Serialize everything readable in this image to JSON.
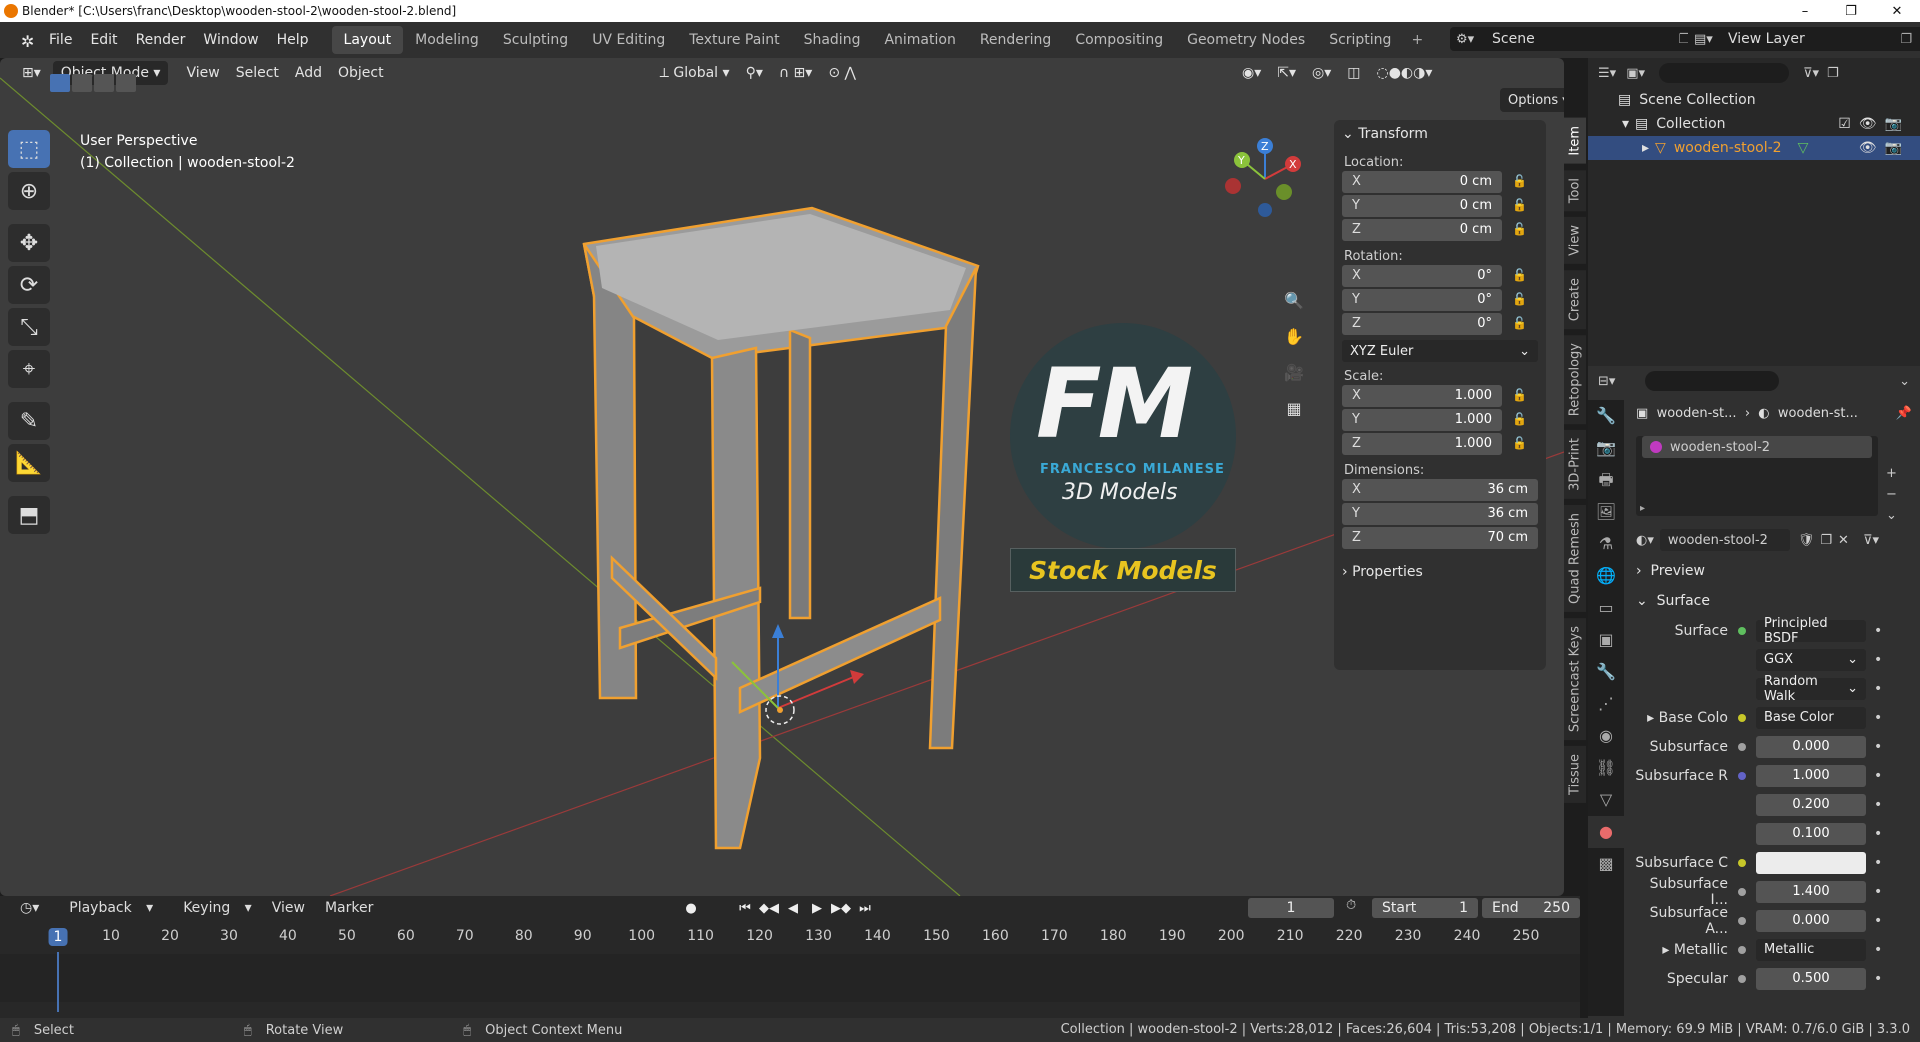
{
  "window": {
    "title": "Blender* [C:\\Users\\franc\\Desktop\\wooden-stool-2\\wooden-stool-2.blend]",
    "minimize": "–",
    "maximize": "❐",
    "close": "✕"
  },
  "menu": [
    "File",
    "Edit",
    "Render",
    "Window",
    "Help"
  ],
  "workspaces": [
    "Layout",
    "Modeling",
    "Sculpting",
    "UV Editing",
    "Texture Paint",
    "Shading",
    "Animation",
    "Rendering",
    "Compositing",
    "Geometry Nodes",
    "Scripting"
  ],
  "workspace_active": "Layout",
  "scene": "Scene",
  "view_layer": "View Layer",
  "viewport": {
    "mode": "Object Mode",
    "menus": [
      "View",
      "Select",
      "Add",
      "Object"
    ],
    "orientation": "Global",
    "options": "Options",
    "info_line1": "User Perspective",
    "info_line2": "(1) Collection | wooden-stool-2"
  },
  "watermark": {
    "letters": "FM",
    "brand": "FRANCESCO MILANESE",
    "tagline": "3D Models",
    "banner": "Stock Models"
  },
  "npanel": {
    "section": "Transform",
    "location_label": "Location:",
    "location": [
      {
        "axis": "X",
        "value": "0 cm"
      },
      {
        "axis": "Y",
        "value": "0 cm"
      },
      {
        "axis": "Z",
        "value": "0 cm"
      }
    ],
    "rotation_label": "Rotation:",
    "rotation": [
      {
        "axis": "X",
        "value": "0°"
      },
      {
        "axis": "Y",
        "value": "0°"
      },
      {
        "axis": "Z",
        "value": "0°"
      }
    ],
    "rotation_mode": "XYZ Euler",
    "scale_label": "Scale:",
    "scale": [
      {
        "axis": "X",
        "value": "1.000"
      },
      {
        "axis": "Y",
        "value": "1.000"
      },
      {
        "axis": "Z",
        "value": "1.000"
      }
    ],
    "dimensions_label": "Dimensions:",
    "dimensions": [
      {
        "axis": "X",
        "value": "36 cm"
      },
      {
        "axis": "Y",
        "value": "36 cm"
      },
      {
        "axis": "Z",
        "value": "70 cm"
      }
    ],
    "properties": "Properties",
    "tabs": [
      "Item",
      "Tool",
      "View",
      "Create",
      "Retopology",
      "3D-Print",
      "Quad Remesh",
      "Screencast Keys",
      "Tissue"
    ]
  },
  "timeline": {
    "menus": [
      "Playback",
      "Keying",
      "View",
      "Marker"
    ],
    "current_frame": "1",
    "start_label": "Start",
    "start": "1",
    "end_label": "End",
    "end": "250",
    "ticks": [
      "1",
      "10",
      "20",
      "30",
      "40",
      "50",
      "60",
      "70",
      "80",
      "90",
      "100",
      "110",
      "120",
      "130",
      "140",
      "150",
      "160",
      "170",
      "180",
      "190",
      "200",
      "210",
      "220",
      "230",
      "240",
      "250"
    ]
  },
  "status": {
    "select": "Select",
    "rotate": "Rotate View",
    "context": "Object Context Menu",
    "stats": "Collection | wooden-stool-2 | Verts:28,012 | Faces:26,604 | Tris:53,208 | Objects:1/1 | Memory: 69.9 MiB | VRAM: 0.7/6.0 GiB | 3.3.0"
  },
  "outliner": {
    "root": "Scene Collection",
    "collection": "Collection",
    "object": "wooden-stool-2"
  },
  "properties": {
    "breadcrumb1": "wooden-st...",
    "breadcrumb2": "wooden-st...",
    "slot": "wooden-stool-2",
    "material": "wooden-stool-2",
    "preview": "Preview",
    "surface_section": "Surface",
    "rows": [
      {
        "label": "Surface",
        "value": "Principled BSDF",
        "kind": "node",
        "dot": "#5fbf5f"
      },
      {
        "label": "",
        "value": "GGX",
        "kind": "drop"
      },
      {
        "label": "",
        "value": "Random Walk",
        "kind": "drop"
      },
      {
        "label": "Base Colo",
        "value": "Base Color",
        "kind": "node",
        "dot": "#c7c729",
        "expand": "▸"
      },
      {
        "label": "Subsurface",
        "value": "0.000",
        "kind": "num",
        "dot": "#a0a0a0"
      },
      {
        "label": "Subsurface R",
        "value": "1.000",
        "kind": "num",
        "dot": "#6363c7"
      },
      {
        "label": "",
        "value": "0.200",
        "kind": "num"
      },
      {
        "label": "",
        "value": "0.100",
        "kind": "num"
      },
      {
        "label": "Subsurface C",
        "value": "",
        "kind": "color",
        "dot": "#c7c729"
      },
      {
        "label": "Subsurface I...",
        "value": "1.400",
        "kind": "num",
        "dot": "#a0a0a0"
      },
      {
        "label": "Subsurface A...",
        "value": "0.000",
        "kind": "num",
        "dot": "#a0a0a0"
      },
      {
        "label": "Metallic",
        "value": "Metallic",
        "kind": "node",
        "dot": "#a0a0a0",
        "expand": "▸"
      },
      {
        "label": "Specular",
        "value": "0.500",
        "kind": "num",
        "dot": "#a0a0a0"
      }
    ]
  },
  "colors": {
    "accent": "#4772b3",
    "selection_outline": "#f0a030",
    "watermark_blue": "#3aa9d6",
    "banner_yellow": "#e8c420"
  }
}
